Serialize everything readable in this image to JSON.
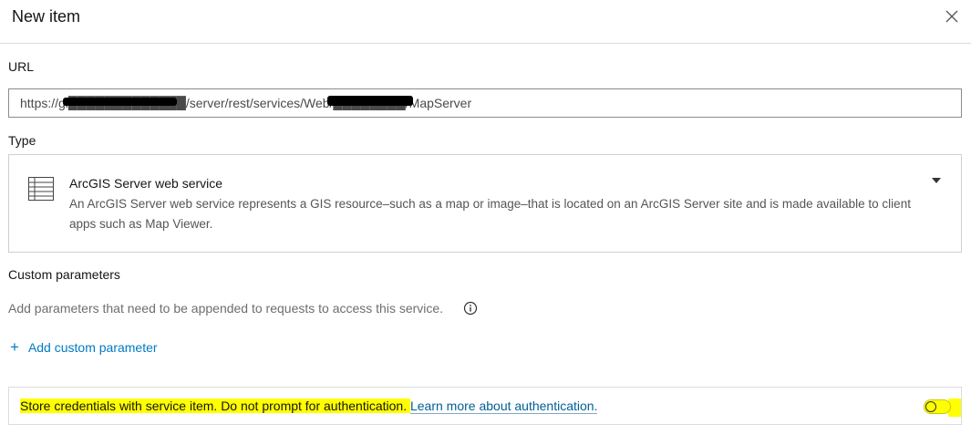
{
  "dialog": {
    "title": "New item",
    "close_icon": "close-icon"
  },
  "url": {
    "label": "URL",
    "value": "https://gi█████████████/server/rest/services/Web/████████/MapServer"
  },
  "type": {
    "label": "Type",
    "icon": "list-table-icon",
    "title": "ArcGIS Server web service",
    "description": "An ArcGIS Server web service represents a GIS resource–such as a map or image–that is located on an ArcGIS Server site and is made available to client apps such as Map Viewer.",
    "dropdown_icon": "caret-down-icon"
  },
  "custom_parameters": {
    "label": "Custom parameters",
    "description": "Add parameters that need to be appended to requests to access this service.",
    "info_icon": "info-icon",
    "add_label": "Add custom parameter"
  },
  "credentials": {
    "text": "Store credentials with service item. Do not prompt for authentication. ",
    "link": "Learn more about authentication.",
    "toggle_on": false
  },
  "colors": {
    "accent": "#007ac2",
    "highlight": "#ffff00",
    "link": "#005e95"
  }
}
